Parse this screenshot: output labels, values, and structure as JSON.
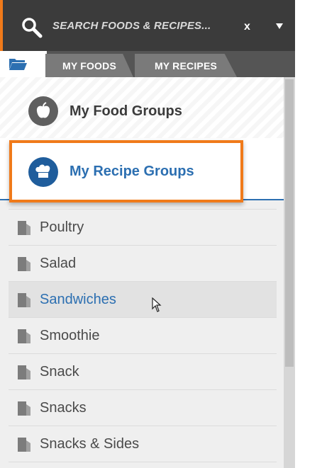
{
  "search": {
    "placeholder": "SEARCH FOODS & RECIPES...",
    "clear_label": "x"
  },
  "tabs": [
    {
      "label": "MY FOODS"
    },
    {
      "label": "MY RECIPES"
    }
  ],
  "groups": {
    "food": {
      "label": "My Food Groups",
      "icon": "apple-icon"
    },
    "recipe": {
      "label": "My Recipe Groups",
      "icon": "chef-hat-icon",
      "active": true
    }
  },
  "recipe_groups": [
    {
      "label": "Poultry"
    },
    {
      "label": "Salad"
    },
    {
      "label": "Sandwiches",
      "selected": true
    },
    {
      "label": "Smoothie"
    },
    {
      "label": "Snack"
    },
    {
      "label": "Snacks"
    },
    {
      "label": "Snacks & Sides"
    }
  ],
  "colors": {
    "accent": "#f07a1a",
    "link_blue": "#2c6fb1",
    "header_dark": "#3b3b3b"
  }
}
